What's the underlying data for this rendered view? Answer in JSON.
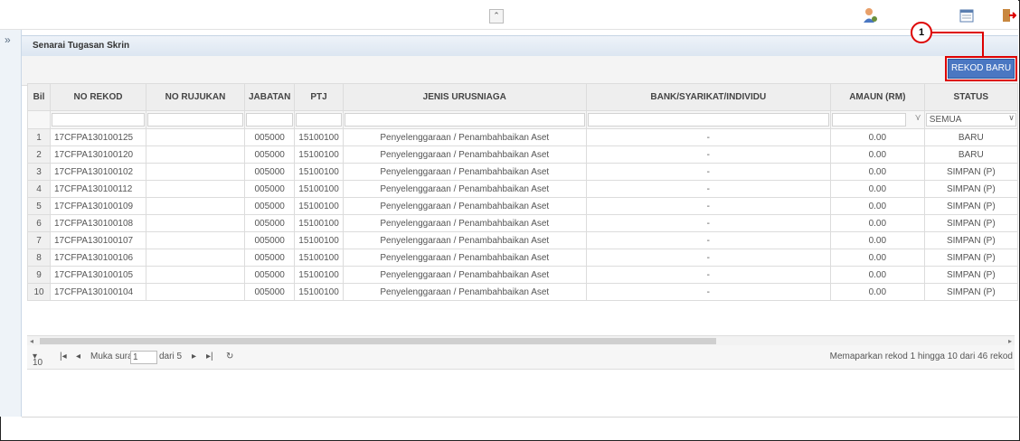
{
  "topbar": {
    "collapse_icon": "double-chevron-up-icon",
    "icons": [
      "user-settings-icon",
      "calendar-icon",
      "logout-icon"
    ]
  },
  "panel": {
    "title": "Senarai Tugasan Skrin",
    "new_button": "REKOD BARU",
    "annotation_number": "1"
  },
  "table": {
    "headers": [
      "Bil",
      "NO REKOD",
      "NO RUJUKAN",
      "JABATAN",
      "PTJ",
      "JENIS URUSNIAGA",
      "BANK/SYARIKAT/INDIVIDU",
      "AMAUN (RM)",
      "STATUS"
    ],
    "status_filter_value": "SEMUA",
    "rows": [
      {
        "bil": "1",
        "no_rekod": "17CFPA130100125",
        "no_rujukan": "",
        "jabatan": "005000",
        "ptj": "15100100",
        "jenis": "Penyelenggaraan / Penambahbaikan Aset",
        "bank": "-",
        "amaun": "0.00",
        "status": "BARU"
      },
      {
        "bil": "2",
        "no_rekod": "17CFPA130100120",
        "no_rujukan": "",
        "jabatan": "005000",
        "ptj": "15100100",
        "jenis": "Penyelenggaraan / Penambahbaikan Aset",
        "bank": "-",
        "amaun": "0.00",
        "status": "BARU"
      },
      {
        "bil": "3",
        "no_rekod": "17CFPA130100102",
        "no_rujukan": "",
        "jabatan": "005000",
        "ptj": "15100100",
        "jenis": "Penyelenggaraan / Penambahbaikan Aset",
        "bank": "-",
        "amaun": "0.00",
        "status": "SIMPAN (P)"
      },
      {
        "bil": "4",
        "no_rekod": "17CFPA130100112",
        "no_rujukan": "",
        "jabatan": "005000",
        "ptj": "15100100",
        "jenis": "Penyelenggaraan / Penambahbaikan Aset",
        "bank": "-",
        "amaun": "0.00",
        "status": "SIMPAN (P)"
      },
      {
        "bil": "5",
        "no_rekod": "17CFPA130100109",
        "no_rujukan": "",
        "jabatan": "005000",
        "ptj": "15100100",
        "jenis": "Penyelenggaraan / Penambahbaikan Aset",
        "bank": "-",
        "amaun": "0.00",
        "status": "SIMPAN (P)"
      },
      {
        "bil": "6",
        "no_rekod": "17CFPA130100108",
        "no_rujukan": "",
        "jabatan": "005000",
        "ptj": "15100100",
        "jenis": "Penyelenggaraan / Penambahbaikan Aset",
        "bank": "-",
        "amaun": "0.00",
        "status": "SIMPAN (P)"
      },
      {
        "bil": "7",
        "no_rekod": "17CFPA130100107",
        "no_rujukan": "",
        "jabatan": "005000",
        "ptj": "15100100",
        "jenis": "Penyelenggaraan / Penambahbaikan Aset",
        "bank": "-",
        "amaun": "0.00",
        "status": "SIMPAN (P)"
      },
      {
        "bil": "8",
        "no_rekod": "17CFPA130100106",
        "no_rujukan": "",
        "jabatan": "005000",
        "ptj": "15100100",
        "jenis": "Penyelenggaraan / Penambahbaikan Aset",
        "bank": "-",
        "amaun": "0.00",
        "status": "SIMPAN (P)"
      },
      {
        "bil": "9",
        "no_rekod": "17CFPA130100105",
        "no_rujukan": "",
        "jabatan": "005000",
        "ptj": "15100100",
        "jenis": "Penyelenggaraan / Penambahbaikan Aset",
        "bank": "-",
        "amaun": "0.00",
        "status": "SIMPAN (P)"
      },
      {
        "bil": "10",
        "no_rekod": "17CFPA130100104",
        "no_rujukan": "",
        "jabatan": "005000",
        "ptj": "15100100",
        "jenis": "Penyelenggaraan / Penambahbaikan Aset",
        "bank": "-",
        "amaun": "0.00",
        "status": "SIMPAN (P)"
      }
    ]
  },
  "pager": {
    "page_size": "10",
    "page_label": "Muka surat",
    "page_value": "1",
    "of_label": "dari 5",
    "summary": "Memaparkan rekod 1 hingga 10 dari 46 rekod"
  }
}
